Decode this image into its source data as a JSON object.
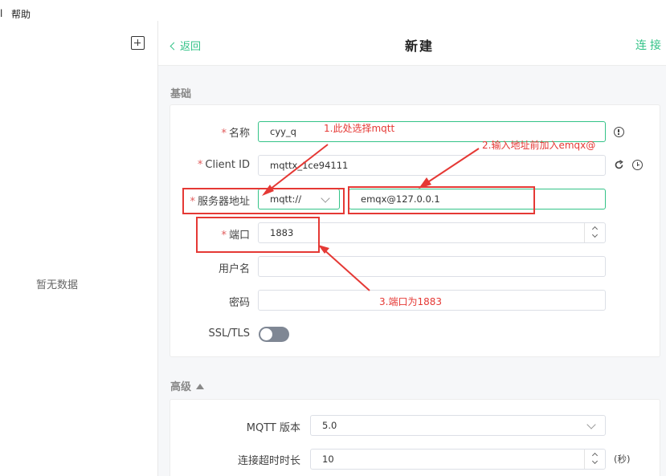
{
  "menubar": {
    "edge_glyph": "l",
    "help": "帮助"
  },
  "sidebar": {
    "empty_text": "暂无数据"
  },
  "header": {
    "back_label": "返回",
    "title": "新建",
    "connect_label": "连接"
  },
  "basic": {
    "section_title": "基础",
    "name": {
      "label": "名称",
      "required": "*",
      "value": "cyy_q"
    },
    "client_id": {
      "label": "Client ID",
      "required": "*",
      "value": "mqttx_1ce94111"
    },
    "host": {
      "label": "服务器地址",
      "required": "*",
      "protocol": "mqtt://",
      "value": "emqx@127.0.0.1"
    },
    "port": {
      "label": "端口",
      "required": "*",
      "value": "1883"
    },
    "username": {
      "label": "用户名",
      "value": ""
    },
    "password": {
      "label": "密码",
      "value": ""
    },
    "ssl": {
      "label": "SSL/TLS",
      "enabled": false
    }
  },
  "advanced": {
    "section_title": "高级",
    "mqtt_version": {
      "label": "MQTT 版本",
      "value": "5.0"
    },
    "connect_timeout": {
      "label": "连接超时时长",
      "value": "10",
      "unit": "(秒)"
    }
  },
  "annotations": {
    "note1": "1.此处选择mqtt",
    "note2": "2.输入地址前加入emqx@",
    "note3": "3.端口为1883",
    "color": "#e53935"
  },
  "colors": {
    "accent": "#34c388",
    "required": "#e15b5b",
    "toggle_off": "#7f8794"
  }
}
